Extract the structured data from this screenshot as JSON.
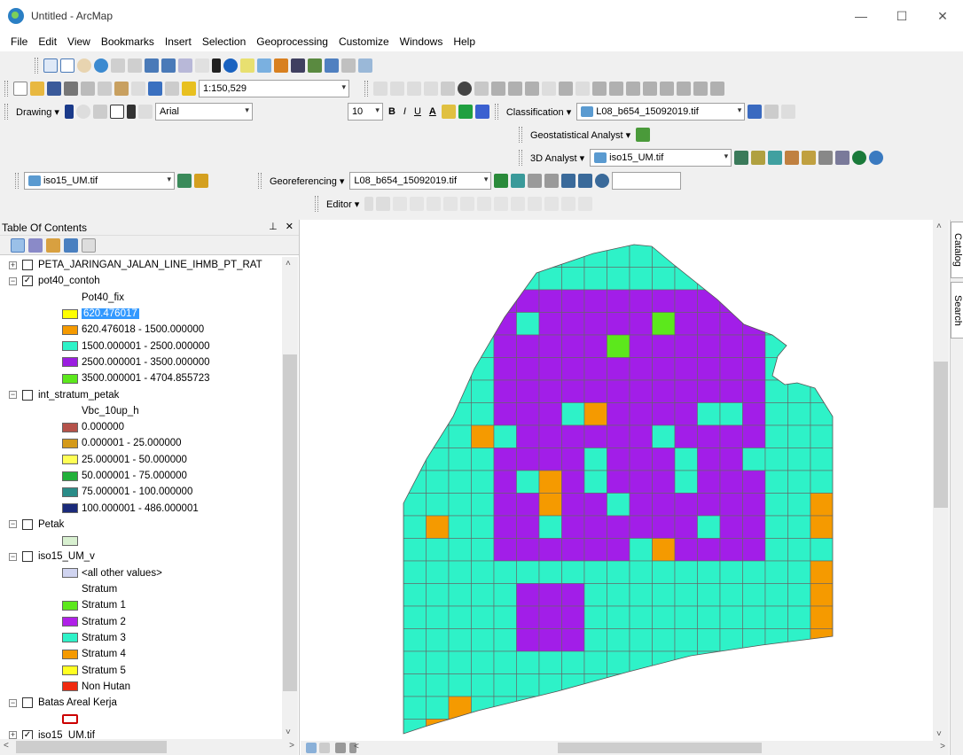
{
  "window": {
    "title": "Untitled - ArcMap",
    "min": "—",
    "max": "☐",
    "close": "✕"
  },
  "menu": [
    "File",
    "Edit",
    "View",
    "Bookmarks",
    "Insert",
    "Selection",
    "Geoprocessing",
    "Customize",
    "Windows",
    "Help"
  ],
  "toolbar": {
    "scale": "1:150,529",
    "drawing_label": "Drawing ▾",
    "font": "Arial",
    "font_size": "10",
    "bold": "B",
    "italic": "I",
    "underline": "U",
    "font_color": "A",
    "classification_label": "Classification ▾",
    "classification_layer": "L08_b654_15092019.tif",
    "geostat_label": "Geostatistical Analyst ▾",
    "analyst3d_label": "3D Analyst ▾",
    "analyst3d_layer": "iso15_UM.tif",
    "layer_combo": "iso15_UM.tif",
    "georef_label": "Georeferencing ▾",
    "georef_layer": "L08_b654_15092019.tif",
    "editor_label": "Editor ▾"
  },
  "toc": {
    "title": "Table Of Contents",
    "pin": "⊥",
    "close": "✕",
    "rows": [
      {
        "type": "layer",
        "expander": "+",
        "checked": false,
        "label": "PETA_JARINGAN_JALAN_LINE_IHMB_PT_RAT"
      },
      {
        "type": "layer",
        "expander": "−",
        "checked": true,
        "label": "pot40_contoh"
      },
      {
        "type": "field",
        "label": "Pot40_fix"
      },
      {
        "type": "class",
        "color": "#ffff00",
        "label": "620.476017",
        "selected": true
      },
      {
        "type": "class",
        "color": "#f59a00",
        "label": "620.476018 - 1500.000000"
      },
      {
        "type": "class",
        "color": "#2ef2c8",
        "label": "1500.000001 - 2500.000000"
      },
      {
        "type": "class",
        "color": "#9b1ee0",
        "label": "2500.000001 - 3500.000000"
      },
      {
        "type": "class",
        "color": "#5ce81c",
        "label": "3500.000001 - 4704.855723"
      },
      {
        "type": "layer",
        "expander": "−",
        "checked": false,
        "label": "int_stratum_petak"
      },
      {
        "type": "field",
        "label": "Vbc_10up_h"
      },
      {
        "type": "class",
        "color": "#b5524a",
        "label": "0.000000"
      },
      {
        "type": "class",
        "color": "#d49a1a",
        "label": "0.000001 - 25.000000"
      },
      {
        "type": "class",
        "color": "#ffff55",
        "label": "25.000001 - 50.000000"
      },
      {
        "type": "class",
        "color": "#22b03a",
        "label": "50.000001 - 75.000000"
      },
      {
        "type": "class",
        "color": "#2a8c88",
        "label": "75.000001 - 100.000000"
      },
      {
        "type": "class",
        "color": "#1a2a7a",
        "label": "100.000001 - 486.000001"
      },
      {
        "type": "layer",
        "expander": "−",
        "checked": false,
        "label": "Petak"
      },
      {
        "type": "class",
        "color": "#d8f0d0",
        "label": ""
      },
      {
        "type": "layer",
        "expander": "−",
        "checked": false,
        "label": "iso15_UM_v"
      },
      {
        "type": "class",
        "color": "#d0d4f0",
        "label": "<all other values>"
      },
      {
        "type": "field",
        "label": "Stratum"
      },
      {
        "type": "class",
        "color": "#5ce81c",
        "label": "Stratum 1"
      },
      {
        "type": "class",
        "color": "#b020e8",
        "label": "Stratum 2"
      },
      {
        "type": "class",
        "color": "#2ef2c8",
        "label": "Stratum 3"
      },
      {
        "type": "class",
        "color": "#f59a00",
        "label": "Stratum 4"
      },
      {
        "type": "class",
        "color": "#ffff22",
        "label": "Stratum 5"
      },
      {
        "type": "class",
        "color": "#f02a10",
        "label": "Non Hutan"
      },
      {
        "type": "layer",
        "expander": "−",
        "checked": false,
        "label": "Batas Areal Kerja"
      },
      {
        "type": "class",
        "color": "hollow",
        "label": ""
      },
      {
        "type": "layer",
        "expander": "+",
        "checked": true,
        "label": "iso15_UM.tif"
      }
    ]
  },
  "side_tabs": [
    "Catalog",
    "Search"
  ],
  "map_colors": {
    "cyan": "#2ef2c8",
    "purple": "#a21ee8",
    "green": "#5ce81c",
    "orange": "#f59a00",
    "yellow": "#ffff22",
    "grid": "#666666"
  }
}
